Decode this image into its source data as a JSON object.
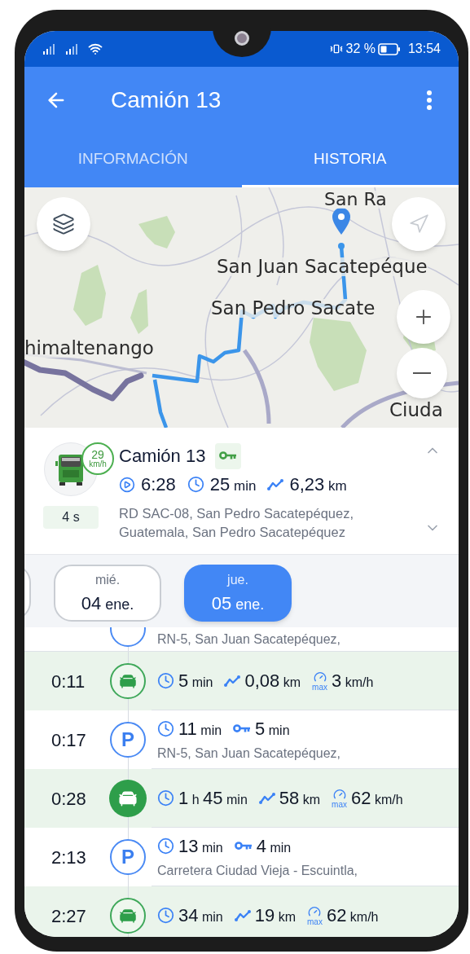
{
  "status_bar": {
    "battery": "32 %",
    "time": "13:54"
  },
  "header": {
    "title": "Camión 13"
  },
  "tabs": [
    {
      "label": "INFORMACIÓN",
      "selected": false
    },
    {
      "label": "HISTORIA",
      "selected": true
    }
  ],
  "map": {
    "labels": [
      {
        "text": "San Ra"
      },
      {
        "text": "San Juan Sacatepéque"
      },
      {
        "text": "San Pedro Sacate"
      },
      {
        "text": "himaltenango"
      },
      {
        "text": "Ciuda"
      }
    ]
  },
  "vehicle": {
    "name": "Camión 13",
    "speed": "29",
    "speed_unit": "km/h",
    "ignition_on": true,
    "age": "4 s",
    "start": "6:28",
    "duration": {
      "value": "25",
      "unit": "min"
    },
    "distance": {
      "value": "6,23",
      "unit": "km"
    },
    "address": "RD SAC-08, San Pedro Sacatepéquez, Guatemala, San Pedro Sacatepéquez"
  },
  "dates": [
    {
      "weekday": "mié.",
      "day": "04",
      "month": "ene.",
      "selected": false
    },
    {
      "weekday": "jue.",
      "day": "05",
      "month": "ene.",
      "selected": true
    }
  ],
  "cut_off_row": {
    "address": "RN-5, San Juan Sacatepéquez,"
  },
  "trips": [
    {
      "kind": "drive",
      "selected": false,
      "time": "0:11",
      "stats": [
        {
          "kind": "duration",
          "parts": [
            {
              "value": "5",
              "unit": "min"
            }
          ]
        },
        {
          "kind": "distance",
          "parts": [
            {
              "value": "0,08",
              "unit": "km"
            }
          ]
        },
        {
          "kind": "max_speed",
          "label": "max",
          "parts": [
            {
              "value": "3",
              "unit": "km/h"
            }
          ]
        }
      ]
    },
    {
      "kind": "park",
      "selected": false,
      "badge": "P",
      "time": "0:17",
      "stats": [
        {
          "kind": "duration",
          "parts": [
            {
              "value": "11",
              "unit": "min"
            }
          ]
        },
        {
          "kind": "ignition",
          "parts": [
            {
              "value": "5",
              "unit": "min"
            }
          ]
        }
      ],
      "address": "RN-5, San Juan Sacatepéquez,"
    },
    {
      "kind": "drive",
      "selected": true,
      "time": "0:28",
      "stats": [
        {
          "kind": "duration",
          "parts": [
            {
              "value": "1",
              "unit": "h"
            },
            {
              "value": "45",
              "unit": "min"
            }
          ]
        },
        {
          "kind": "distance",
          "parts": [
            {
              "value": "58",
              "unit": "km"
            }
          ]
        },
        {
          "kind": "max_speed",
          "label": "max",
          "parts": [
            {
              "value": "62",
              "unit": "km/h"
            }
          ]
        }
      ]
    },
    {
      "kind": "park",
      "selected": false,
      "badge": "P",
      "time": "2:13",
      "stats": [
        {
          "kind": "duration",
          "parts": [
            {
              "value": "13",
              "unit": "min"
            }
          ]
        },
        {
          "kind": "ignition",
          "parts": [
            {
              "value": "4",
              "unit": "min"
            }
          ]
        }
      ],
      "address": "Carretera Ciudad Vieja - Escuintla,"
    },
    {
      "kind": "drive",
      "selected": false,
      "time": "2:27",
      "stats": [
        {
          "kind": "duration",
          "parts": [
            {
              "value": "34",
              "unit": "min"
            }
          ]
        },
        {
          "kind": "distance",
          "parts": [
            {
              "value": "19",
              "unit": "km"
            }
          ]
        },
        {
          "kind": "max_speed",
          "label": "max",
          "parts": [
            {
              "value": "62",
              "unit": "km/h"
            }
          ]
        }
      ]
    }
  ]
}
